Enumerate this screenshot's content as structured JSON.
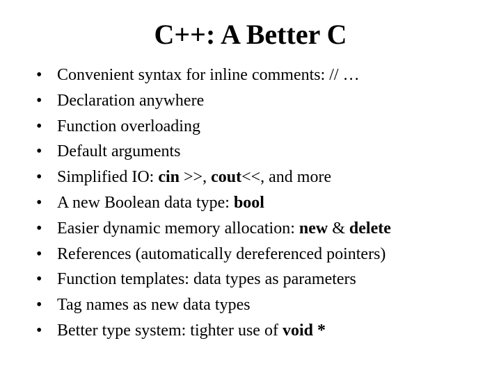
{
  "title": "C++: A Better C",
  "bullets": [
    {
      "segments": [
        {
          "text": "Convenient syntax for inline comments: // …",
          "bold": false
        }
      ]
    },
    {
      "segments": [
        {
          "text": "Declaration anywhere",
          "bold": false
        }
      ]
    },
    {
      "segments": [
        {
          "text": "Function overloading",
          "bold": false
        }
      ]
    },
    {
      "segments": [
        {
          "text": "Default arguments",
          "bold": false
        }
      ]
    },
    {
      "segments": [
        {
          "text": "Simplified IO: ",
          "bold": false
        },
        {
          "text": "cin",
          "bold": true
        },
        {
          "text": " >>, ",
          "bold": false
        },
        {
          "text": "cout",
          "bold": true
        },
        {
          "text": "<<, and more",
          "bold": false
        }
      ]
    },
    {
      "segments": [
        {
          "text": "A new Boolean data type: ",
          "bold": false
        },
        {
          "text": "bool",
          "bold": true
        }
      ]
    },
    {
      "segments": [
        {
          "text": "Easier dynamic memory allocation: ",
          "bold": false
        },
        {
          "text": "new",
          "bold": true
        },
        {
          "text": " & ",
          "bold": false
        },
        {
          "text": "delete",
          "bold": true
        }
      ]
    },
    {
      "segments": [
        {
          "text": "References (automatically dereferenced pointers)",
          "bold": false
        }
      ]
    },
    {
      "segments": [
        {
          "text": "Function templates: data types as parameters",
          "bold": false
        }
      ]
    },
    {
      "segments": [
        {
          "text": "Tag names as new data types",
          "bold": false
        }
      ]
    },
    {
      "segments": [
        {
          "text": "Better type system: tighter use of ",
          "bold": false
        },
        {
          "text": "void *",
          "bold": true
        }
      ]
    }
  ]
}
